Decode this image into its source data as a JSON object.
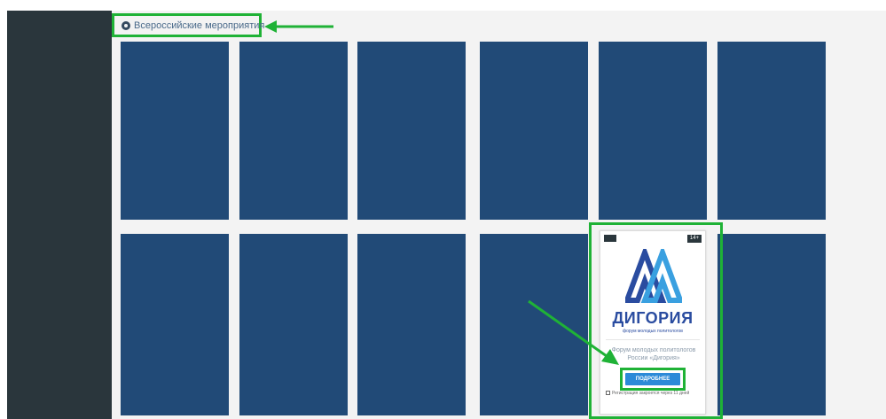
{
  "section": {
    "title": "Всероссийские мероприятия",
    "icon": "globe-icon"
  },
  "cards": {
    "row1_count": 6,
    "row2_count": 5,
    "color": "#214a77"
  },
  "featured": {
    "age_badge": "14+",
    "brand": "ДИГОРИЯ",
    "brand_subtitle": "форум молодых политологов",
    "title": "Форум молодых политологов России «Дигория»",
    "button_label": "ПОДРОБНЕЕ",
    "registration": "Регистрация закроется через 11 дней"
  },
  "colors": {
    "highlight": "#1fb236",
    "sidebar": "#2a363c",
    "brand": "#2a4ca0",
    "button": "#2c8ad8"
  }
}
